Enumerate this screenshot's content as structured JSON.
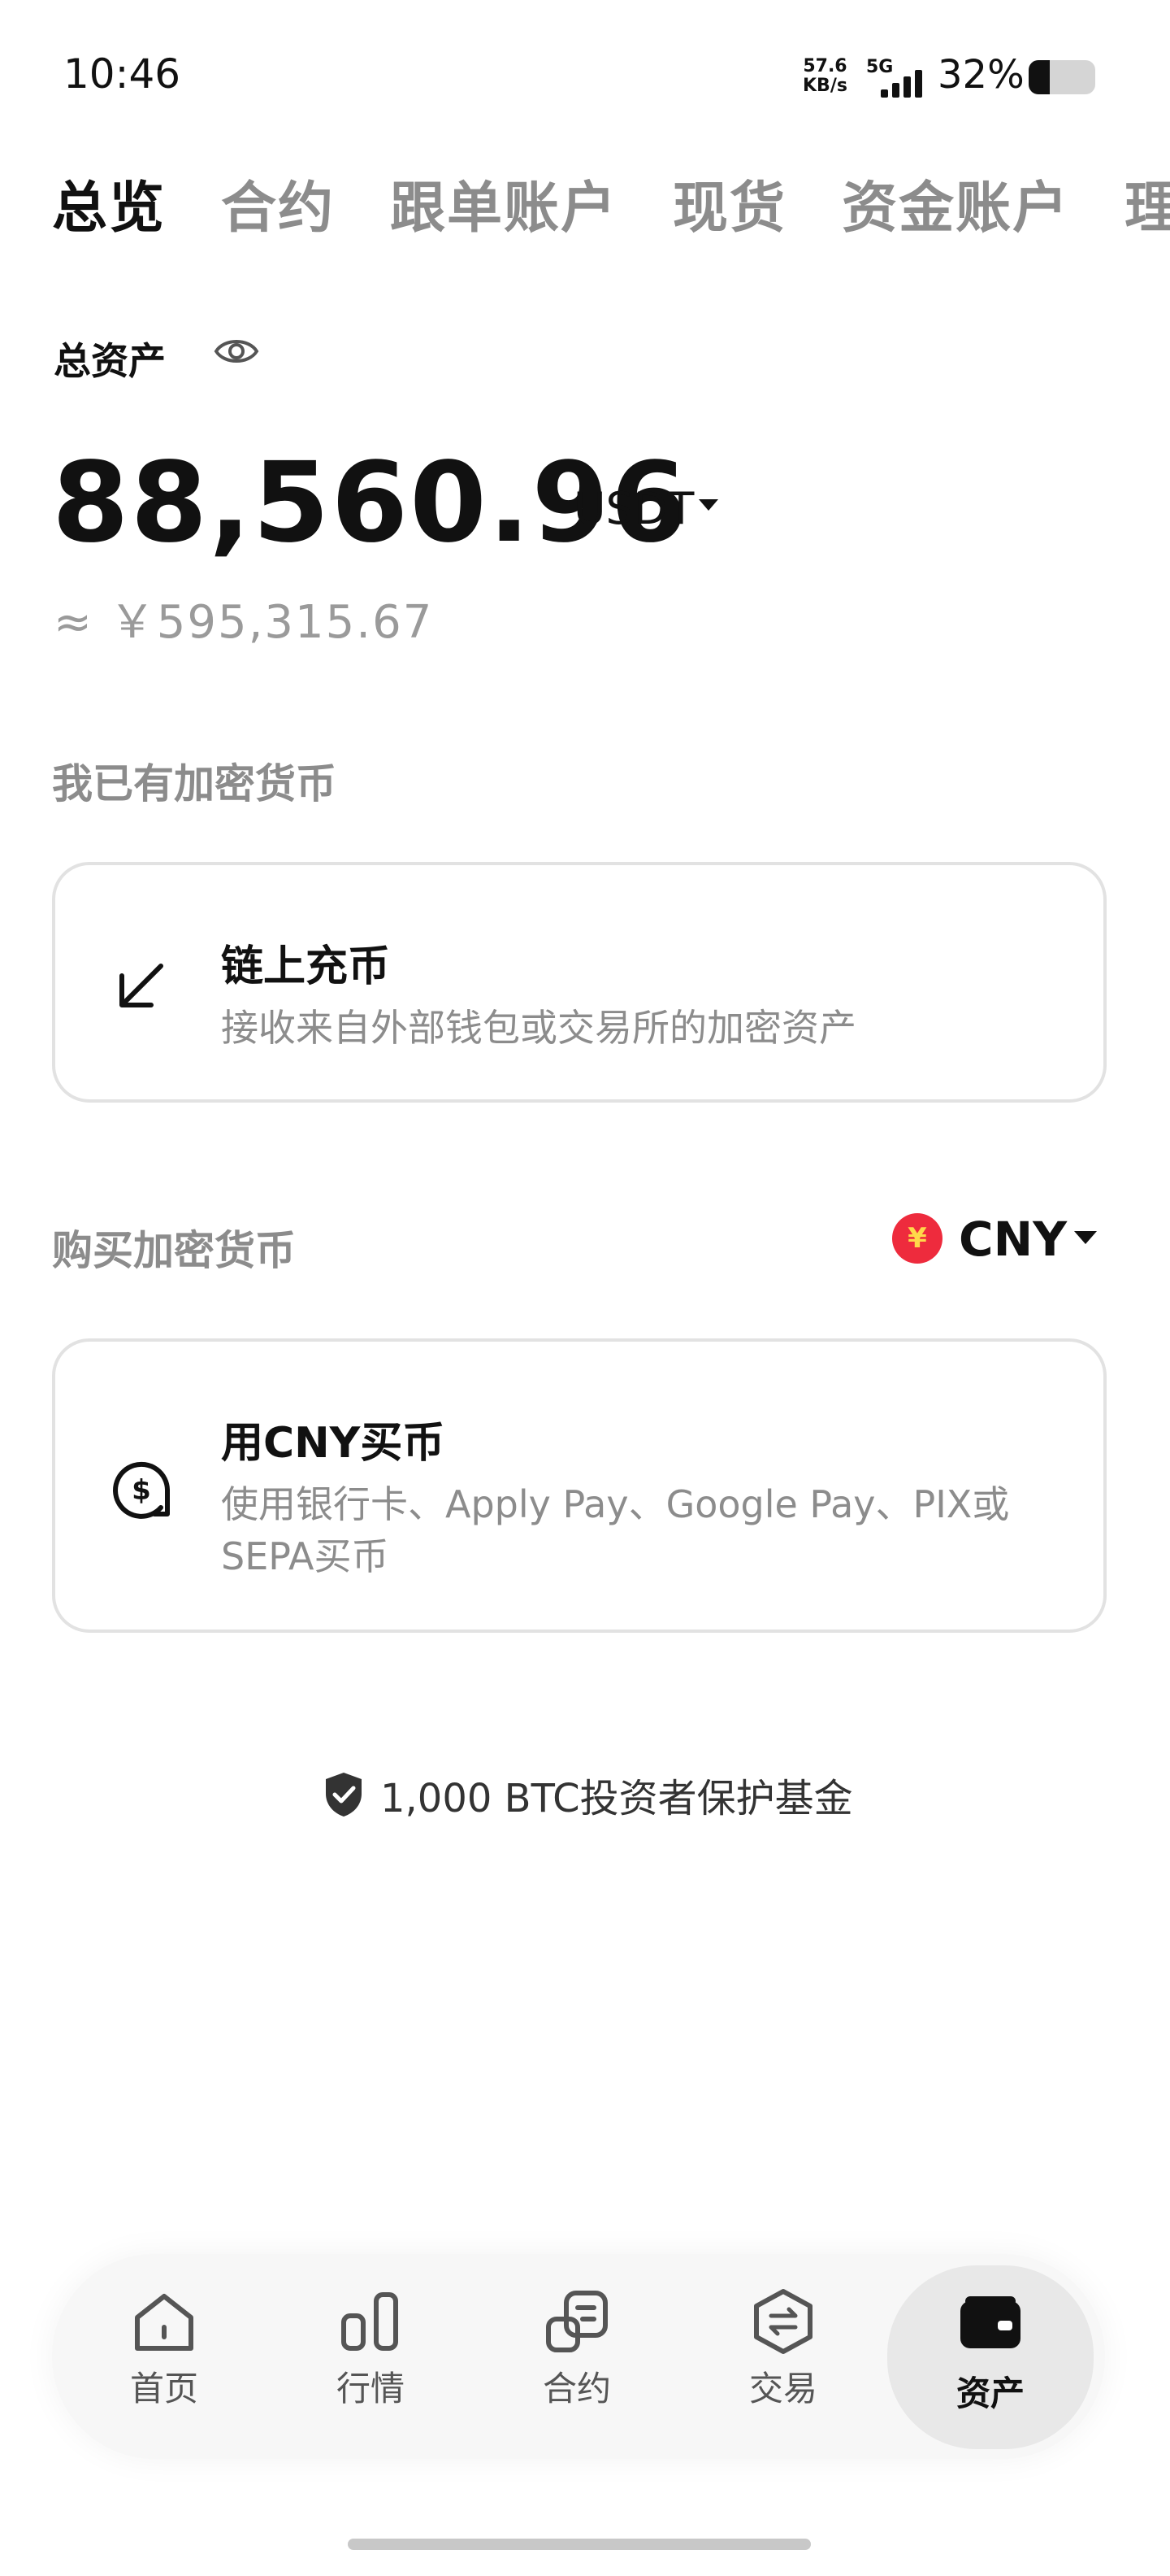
{
  "status_bar": {
    "time": "10:46",
    "net_speed_value": "57.6",
    "net_speed_unit": "KB/s",
    "network": "5G",
    "battery_percent": "32%",
    "battery_level": 0.32
  },
  "tabs": [
    {
      "label": "总览",
      "active": true
    },
    {
      "label": "合约",
      "active": false
    },
    {
      "label": "跟单账户",
      "active": false
    },
    {
      "label": "现货",
      "active": false
    },
    {
      "label": "资金账户",
      "active": false
    },
    {
      "label": "理",
      "active": false
    }
  ],
  "assets": {
    "label": "总资产",
    "amount": "88,560.96",
    "unit": "USDT",
    "approx": "≈ ￥595,315.67"
  },
  "have_crypto": {
    "section_title": "我已有加密货币",
    "card_title": "链上充币",
    "card_subtitle": "接收来自外部钱包或交易所的加密资产"
  },
  "buy_crypto": {
    "section_title": "购买加密货币",
    "currency_symbol": "¥",
    "currency": "CNY",
    "card_title": "用CNY买币",
    "card_subtitle_line1": "使用银行卡、Apply Pay、Google Pay、PIX或",
    "card_subtitle_line2": "SEPA买币"
  },
  "protection": {
    "text": "1,000 BTC投资者保护基金"
  },
  "bottom_nav": [
    {
      "label": "首页",
      "icon": "home-icon"
    },
    {
      "label": "行情",
      "icon": "market-icon"
    },
    {
      "label": "合约",
      "icon": "contract-icon"
    },
    {
      "label": "交易",
      "icon": "trade-icon"
    },
    {
      "label": "资产",
      "icon": "wallet-icon",
      "active": true
    }
  ],
  "colors": {
    "active_text": "#111111",
    "inactive_text": "#8c8c8c",
    "cny_badge": "#ee2b3d"
  }
}
